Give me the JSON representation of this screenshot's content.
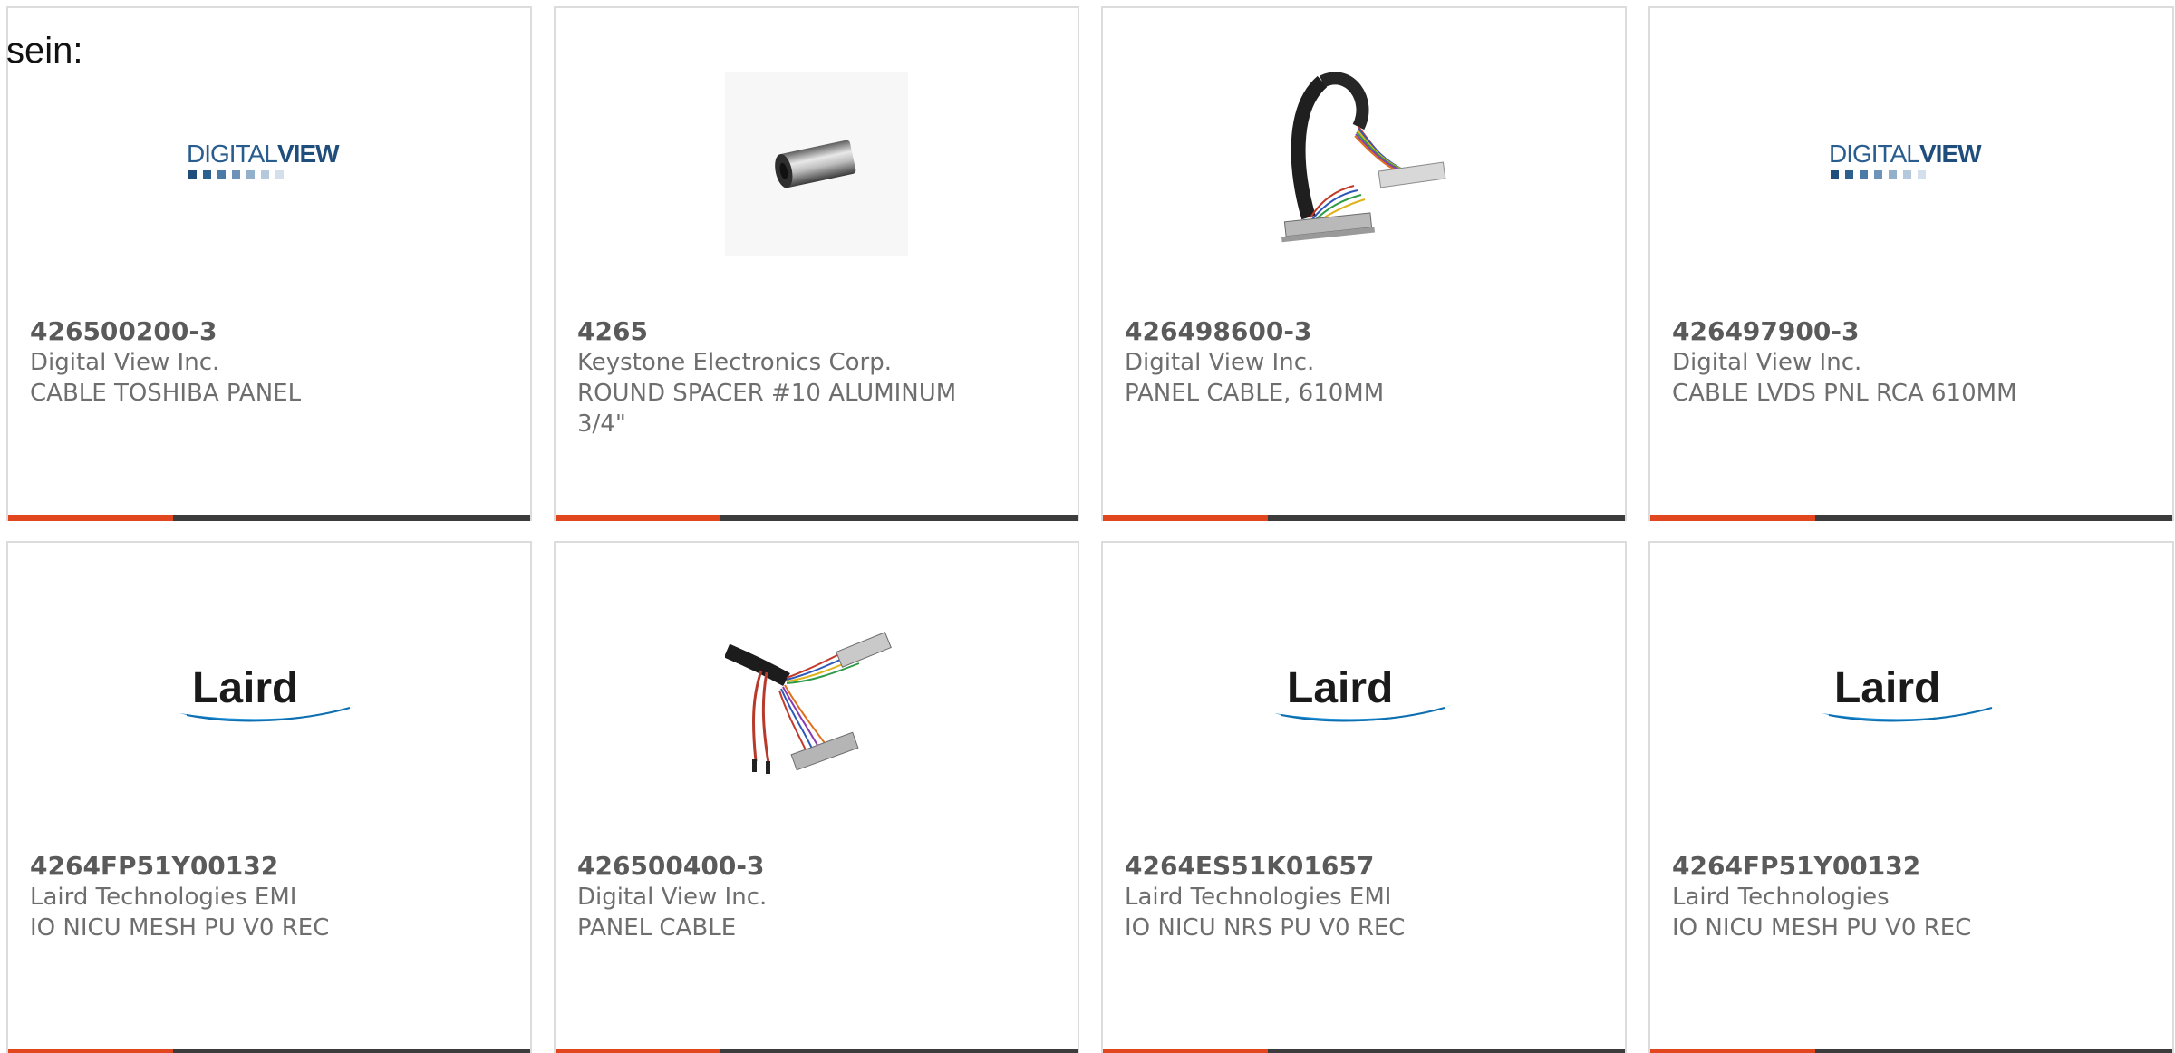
{
  "intro_text": "sein:",
  "colors": {
    "accent_bar": "#e1461e",
    "dark_bar": "#3c3c3c",
    "card_border": "#dcdcdc",
    "text": "#6e6e6e"
  },
  "cards": [
    {
      "part_number": "426500200-3",
      "manufacturer": "Digital View Inc.",
      "description": "CABLE TOSHIBA PANEL",
      "image": "digitalview-logo",
      "logo_text_a": "DIGITAL",
      "logo_text_b": "VIEW"
    },
    {
      "part_number": "4265",
      "manufacturer": "Keystone Electronics Corp.",
      "description": "ROUND SPACER #10 ALUMINUM 3/4\"",
      "image": "aluminum-spacer-photo"
    },
    {
      "part_number": "426498600-3",
      "manufacturer": "Digital View Inc.",
      "description": "PANEL CABLE, 610MM",
      "image": "panel-cable-photo"
    },
    {
      "part_number": "426497900-3",
      "manufacturer": "Digital View Inc.",
      "description": "CABLE LVDS PNL RCA 610MM",
      "image": "digitalview-logo",
      "logo_text_a": "DIGITAL",
      "logo_text_b": "VIEW"
    },
    {
      "part_number": "4264FP51Y00132",
      "manufacturer": "Laird Technologies EMI",
      "description": "IO NICU MESH PU V0 REC",
      "image": "laird-logo",
      "logo_text": "Laird"
    },
    {
      "part_number": "426500400-3",
      "manufacturer": "Digital View Inc.",
      "description": "PANEL CABLE",
      "image": "ribbon-cable-photo"
    },
    {
      "part_number": "4264ES51K01657",
      "manufacturer": "Laird Technologies EMI",
      "description": "IO NICU NRS PU V0 REC",
      "image": "laird-logo",
      "logo_text": "Laird"
    },
    {
      "part_number": "4264FP51Y00132",
      "manufacturer": "Laird Technologies",
      "description": "IO NICU MESH PU V0 REC",
      "image": "laird-logo",
      "logo_text": "Laird"
    }
  ]
}
